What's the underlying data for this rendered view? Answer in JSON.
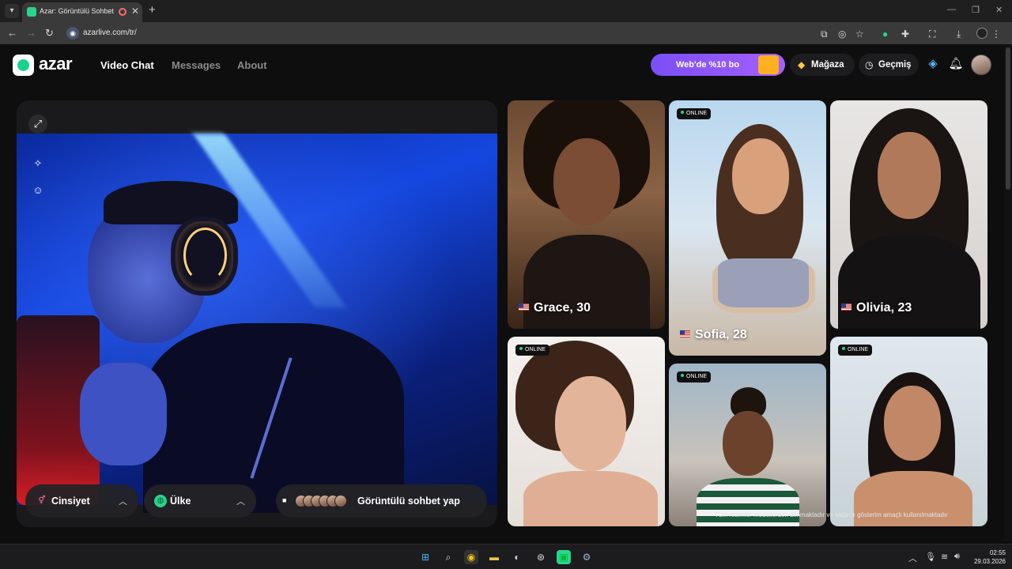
{
  "browser": {
    "tab_title": "Azar: Görüntülü Sohbet & Video",
    "url": "azarlive.com/tr/",
    "icons": [
      "tab-list-icon",
      "favicon-icon",
      "recording-icon",
      "close-icon",
      "new-tab-icon",
      "back-icon",
      "forward-icon",
      "reload-icon",
      "site-info-icon",
      "screen-share-icon",
      "eye-off-icon",
      "star-icon",
      "extension-icon",
      "puzzle-icon",
      "translate-icon",
      "download-icon",
      "profile-icon",
      "menu-icon"
    ]
  },
  "header": {
    "logo_text": "azar",
    "nav": [
      {
        "label": "Video Chat",
        "active": true
      },
      {
        "label": "Messages",
        "active": false
      },
      {
        "label": "About",
        "active": false
      }
    ],
    "promo_label": "Web'de %10 bo",
    "store_label": "Mağaza",
    "history_label": "Geçmiş"
  },
  "video": {
    "tools": [
      "expand-icon",
      "magic-wand-icon",
      "face-filter-icon"
    ],
    "gender_label": "Cinsiyet",
    "country_label": "Ülke",
    "start_label": "Görüntülü sohbet yap"
  },
  "profiles": [
    {
      "name": "Grace, 30",
      "online": false
    },
    {
      "name": "Sofia, 28",
      "online": true
    },
    {
      "name": "Olivia, 23",
      "online": false
    },
    {
      "name": "",
      "online": true
    },
    {
      "name": "",
      "online": true
    },
    {
      "name": "",
      "online": true
    }
  ],
  "online_badge": "ONLINE",
  "disclaimer": "Tüm resimler modellerden alınmaktadır ve sadece gösterim amaçlı kullanılmaktadır",
  "taskbar": {
    "time": "02:55",
    "date": "29.03.2026"
  },
  "colors": {
    "brand_green": "#2bd48a",
    "promo_purple": "#8a55f7",
    "background": "#0e0e0f"
  }
}
